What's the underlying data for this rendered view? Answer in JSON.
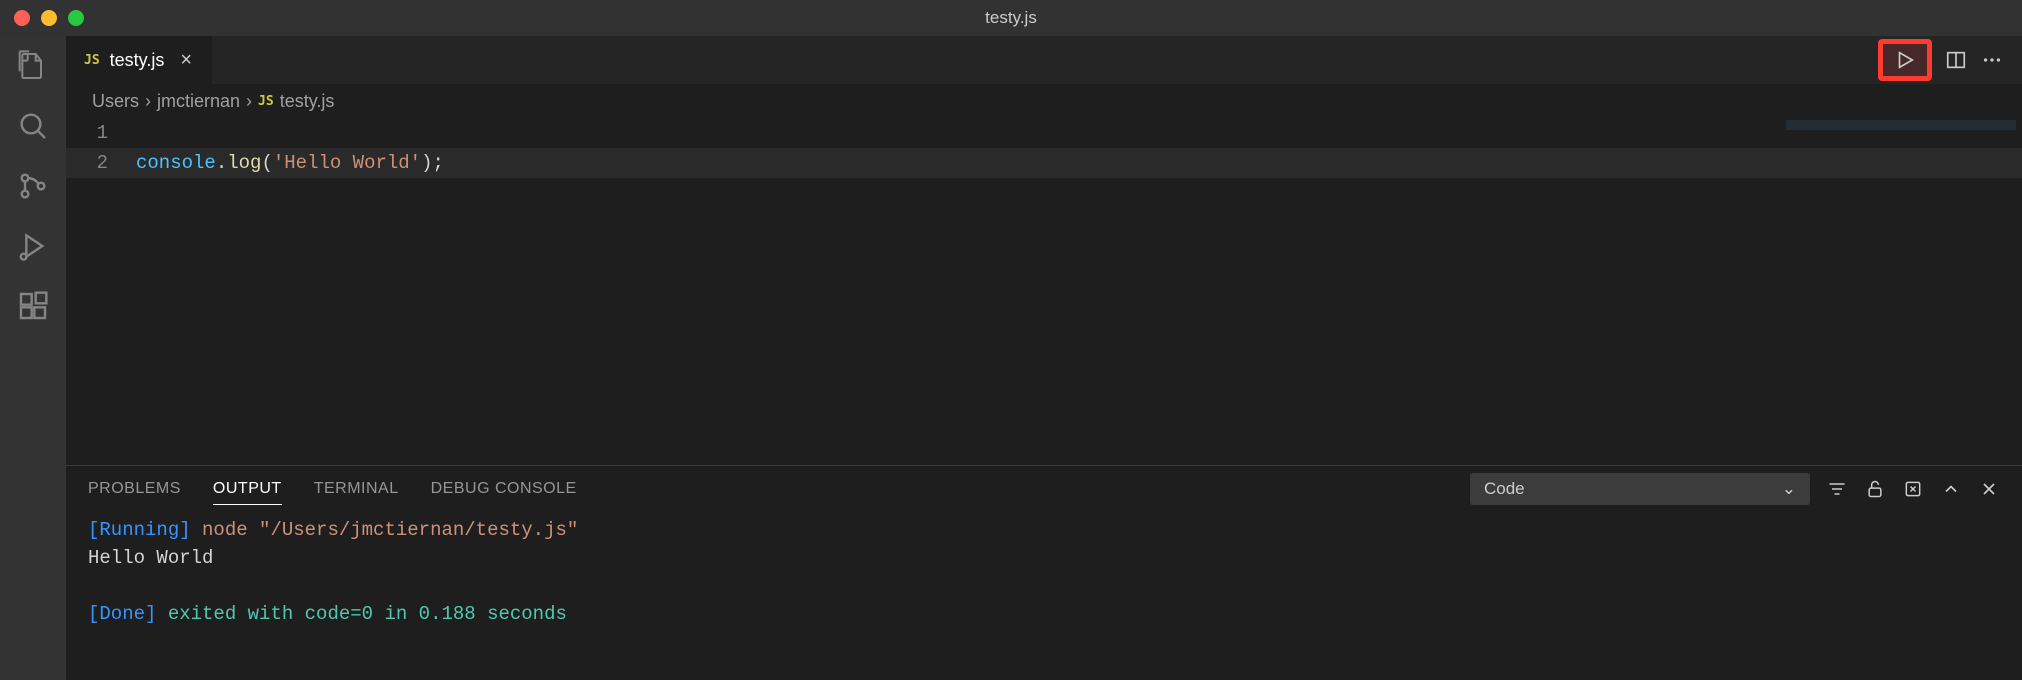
{
  "window": {
    "title": "testy.js"
  },
  "tab": {
    "label": "testy.js",
    "lang_badge": "JS"
  },
  "breadcrumbs": {
    "items": [
      "Users",
      "jmctiernan"
    ],
    "file_badge": "JS",
    "file": "testy.js"
  },
  "editor": {
    "lines": [
      {
        "num": "1",
        "tokens": []
      },
      {
        "num": "2",
        "tokens": [
          {
            "c": "tok-obj",
            "t": "console"
          },
          {
            "c": "tok-punct",
            "t": "."
          },
          {
            "c": "tok-func",
            "t": "log"
          },
          {
            "c": "tok-punct",
            "t": "("
          },
          {
            "c": "tok-str",
            "t": "'Hello World'"
          },
          {
            "c": "tok-punct",
            "t": ");"
          }
        ]
      }
    ]
  },
  "panel": {
    "tabs": [
      "PROBLEMS",
      "OUTPUT",
      "TERMINAL",
      "DEBUG CONSOLE"
    ],
    "active_tab": "OUTPUT",
    "selector": "Code",
    "output": {
      "running_label": "[Running]",
      "running_cmd": " node \"/Users/jmctiernan/testy.js\"",
      "stdout": "Hello World",
      "done_label": "[Done]",
      "done_msg": " exited with code=0 in 0.188 seconds"
    }
  }
}
